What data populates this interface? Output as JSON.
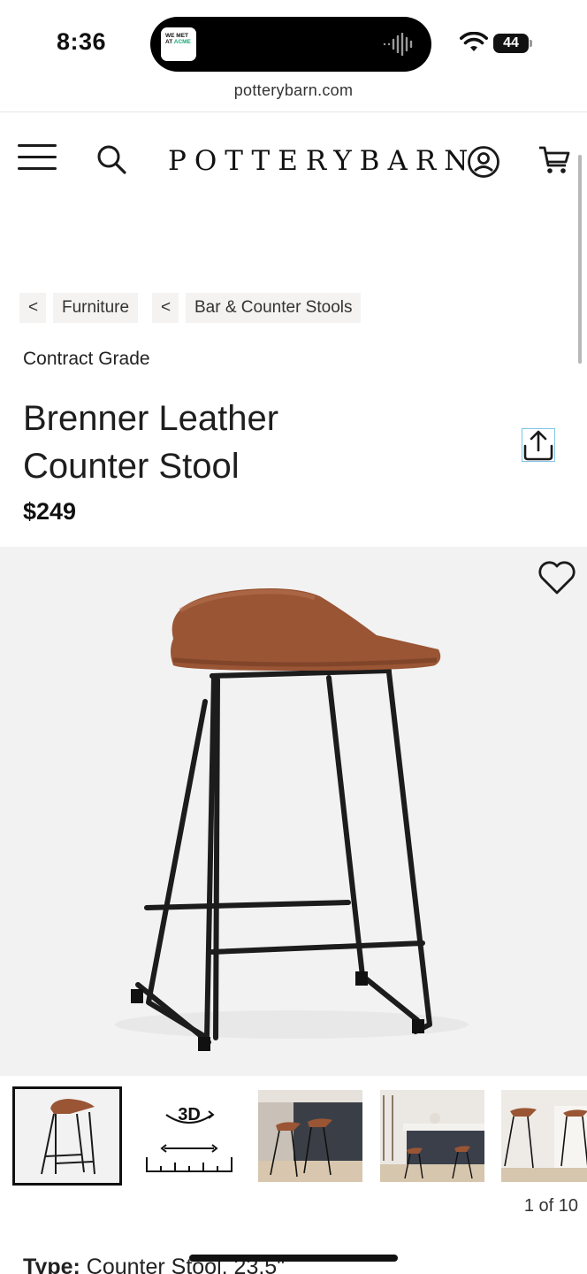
{
  "status_bar": {
    "time": "8:36",
    "battery_level": "44",
    "island_app": {
      "line1": "WE MET",
      "line2": "AT ",
      "brand": "ACME",
      "icon": "podcast-app-icon"
    }
  },
  "browser": {
    "url": "potterybarn.com"
  },
  "header": {
    "logo": "POTTERYBARN",
    "icons": [
      "menu-icon",
      "search-icon",
      "account-icon",
      "cart-icon"
    ]
  },
  "breadcrumbs": {
    "back_glyph": "<",
    "items": [
      {
        "label": "Furniture"
      },
      {
        "label": "Bar & Counter Stools"
      }
    ]
  },
  "product": {
    "grade": "Contract Grade",
    "title_line1": "Brenner Leather",
    "title_line2": "Counter Stool",
    "price": "$249",
    "colors": {
      "seat": "#9a5535",
      "frame": "#1c1c1c",
      "background": "#f2f2f2"
    }
  },
  "gallery": {
    "thumbnails": [
      {
        "kind": "product-photo"
      },
      {
        "kind": "3d-view",
        "label": "3D"
      },
      {
        "kind": "lifestyle-photo"
      },
      {
        "kind": "lifestyle-photo"
      },
      {
        "kind": "lifestyle-photo"
      }
    ],
    "counter": "1 of 10"
  },
  "details": {
    "type_label": "Type:",
    "type_value": " Counter Stool, 23.5\""
  }
}
